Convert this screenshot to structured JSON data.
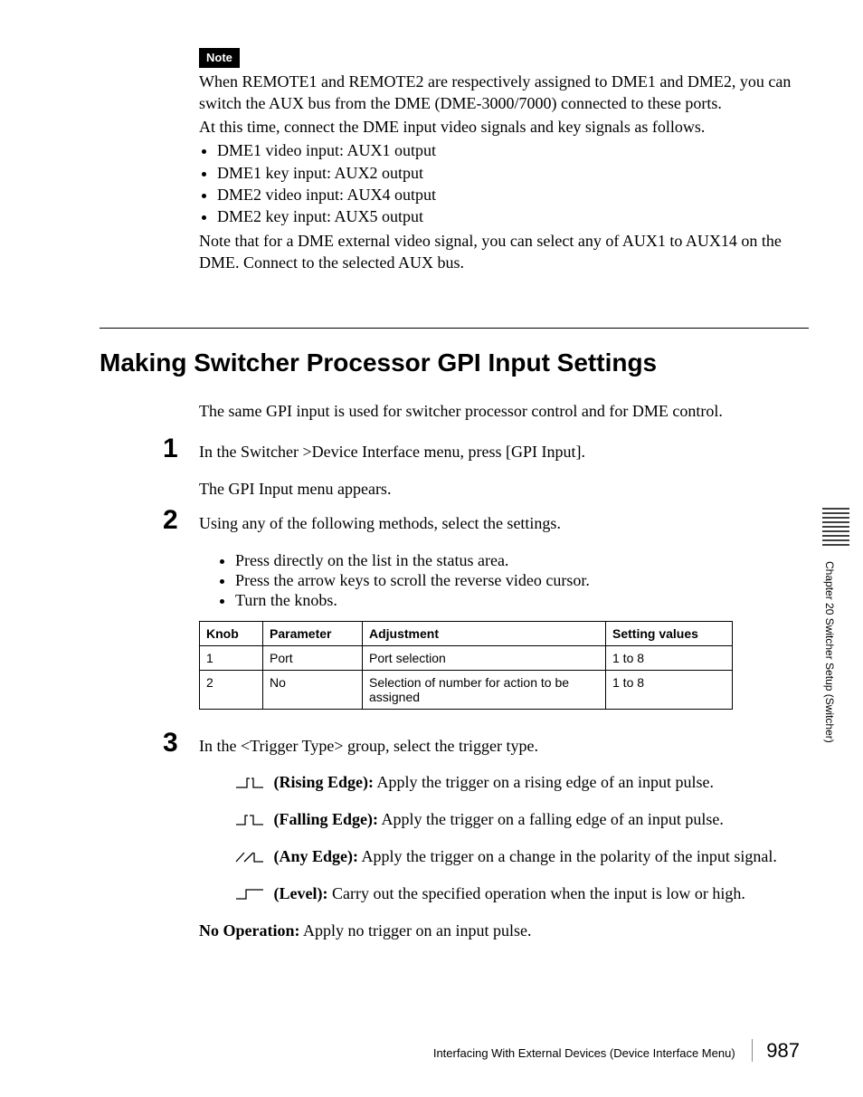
{
  "note": {
    "label": "Note",
    "para1": "When REMOTE1 and REMOTE2 are respectively assigned to DME1 and DME2, you can switch the AUX bus from the DME (DME-3000/7000) connected to these ports.",
    "para2": "At this time, connect the DME input video signals and key signals as follows.",
    "bullets": [
      "DME1 video input: AUX1 output",
      "DME1 key input: AUX2 output",
      "DME2 video input: AUX4 output",
      "DME2 key input: AUX5 output"
    ],
    "para3": "Note that for a DME external video signal, you can select any of AUX1 to AUX14 on the DME. Connect to the selected AUX bus."
  },
  "section_title": "Making Switcher Processor GPI Input Settings",
  "intro": "The same GPI input is used for switcher processor control and for DME control.",
  "step1": {
    "num": "1",
    "text": "In the Switcher >Device Interface menu, press [GPI Input].",
    "subtext": "The GPI Input menu appears."
  },
  "step2": {
    "num": "2",
    "text": "Using any of the following methods, select the settings.",
    "bullets": [
      "Press directly on the list in the status area.",
      "Press the arrow keys to scroll the reverse video cursor.",
      "Turn the knobs."
    ],
    "table": {
      "headers": [
        "Knob",
        "Parameter",
        "Adjustment",
        "Setting values"
      ],
      "rows": [
        [
          "1",
          "Port",
          "Port selection",
          "1 to 8"
        ],
        [
          "2",
          "No",
          "Selection of number for action to be assigned",
          "1 to 8"
        ]
      ]
    }
  },
  "step3": {
    "num": "3",
    "text": "In the <Trigger Type> group, select the trigger type.",
    "triggers": [
      {
        "label": " (Rising Edge):",
        "desc": " Apply the trigger on a rising edge of an input pulse."
      },
      {
        "label": " (Falling Edge):",
        "desc": " Apply the trigger on a falling edge of an input pulse."
      },
      {
        "label": " (Any Edge):",
        "desc": " Apply the trigger on a change in the polarity of the input signal."
      },
      {
        "label": " (Level):",
        "desc": " Carry out the specified operation when the input is low or high."
      },
      {
        "label": "No Operation:",
        "desc": " Apply no trigger on an input pulse."
      }
    ]
  },
  "sidebar": "Chapter 20  Switcher Setup (Switcher)",
  "footer": {
    "text": "Interfacing With External Devices (Device Interface Menu)",
    "page": "987"
  }
}
